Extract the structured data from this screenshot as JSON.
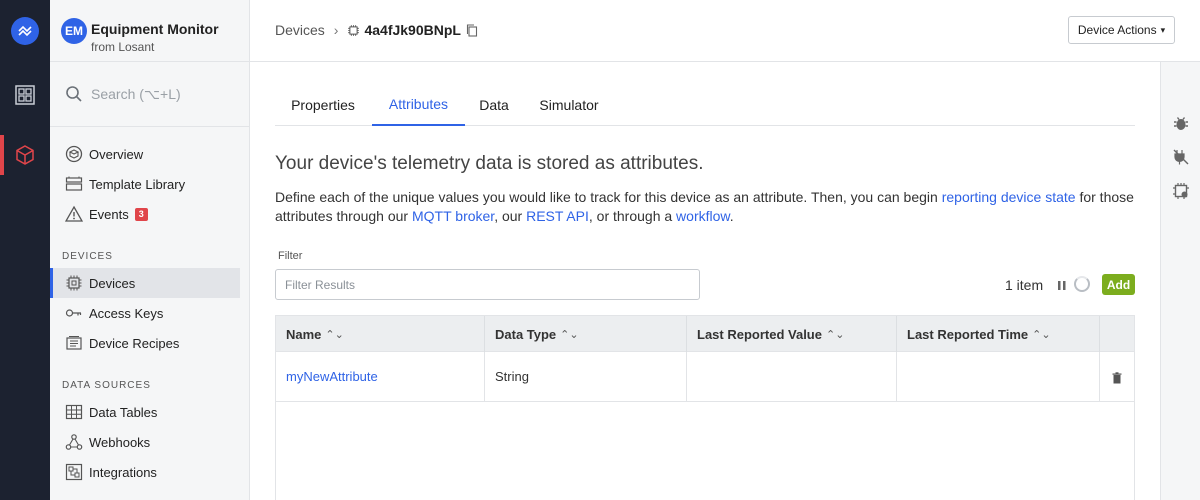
{
  "app": {
    "badge": "EM",
    "title": "Equipment Monitor",
    "subtitle": "from Losant"
  },
  "search": {
    "placeholder": "Search (⌥+L)"
  },
  "sidebar": {
    "items": [
      {
        "label": "Overview",
        "icon": "overview-icon"
      },
      {
        "label": "Template Library",
        "icon": "template-library-icon"
      },
      {
        "label": "Events",
        "icon": "warning-icon",
        "badge": "3"
      }
    ],
    "devices_section": "DEVICES",
    "device_items": [
      {
        "label": "Devices",
        "icon": "device-chip-icon",
        "active": true
      },
      {
        "label": "Access Keys",
        "icon": "key-icon"
      },
      {
        "label": "Device Recipes",
        "icon": "recipe-icon"
      }
    ],
    "data_section": "DATA SOURCES",
    "data_items": [
      {
        "label": "Data Tables",
        "icon": "table-icon"
      },
      {
        "label": "Webhooks",
        "icon": "webhook-icon"
      },
      {
        "label": "Integrations",
        "icon": "integrations-icon"
      }
    ]
  },
  "breadcrumb": {
    "root": "Devices",
    "separator": "›",
    "device_id": "4a4fJk90BNpL"
  },
  "device_actions": {
    "label": "Device Actions",
    "caret": "▾"
  },
  "tabs": [
    {
      "label": "Properties",
      "active": false
    },
    {
      "label": "Attributes",
      "active": true
    },
    {
      "label": "Data",
      "active": false
    },
    {
      "label": "Simulator",
      "active": false
    }
  ],
  "main": {
    "heading": "Your device's telemetry data is stored as attributes.",
    "desc_1": "Define each of the unique values you would like to track for this device as an attribute. Then, you can begin ",
    "link_reporting": "reporting device state",
    "desc_2": " for those attributes through our ",
    "link_mqtt": "MQTT broker",
    "desc_3": ", our ",
    "link_rest": "REST API",
    "desc_4": ", or through a ",
    "link_workflow": "workflow",
    "desc_5": "."
  },
  "filter": {
    "label": "Filter",
    "placeholder": "Filter Results"
  },
  "list_meta": {
    "count": "1 item",
    "add_label": "Add"
  },
  "table": {
    "columns": [
      "Name",
      "Data Type",
      "Last Reported Value",
      "Last Reported Time"
    ],
    "sort_glyph": "⌃⌄",
    "rows": [
      {
        "name": "myNewAttribute",
        "type": "String",
        "value": "",
        "time": ""
      }
    ]
  },
  "colors": {
    "accent": "#2f63e6",
    "rail": "#1c2230",
    "add_button": "#7cad1e",
    "badge_red": "#e0454a"
  }
}
